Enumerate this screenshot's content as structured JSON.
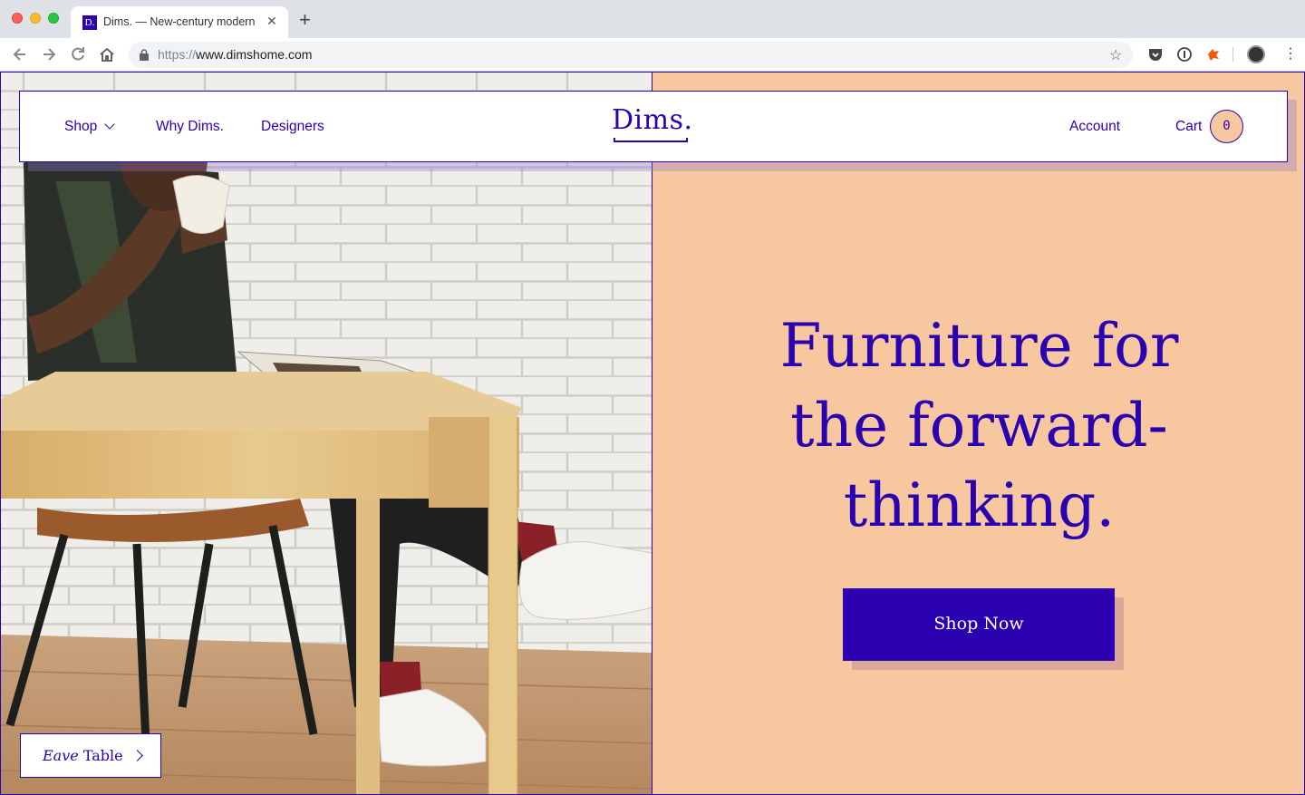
{
  "browser": {
    "tab_title": "Dims. — New-century modern",
    "favicon_text": "D.",
    "url_scheme": "https://",
    "url_host": "www.dimshome.com"
  },
  "header": {
    "nav": {
      "shop": "Shop",
      "why": "Why Dims.",
      "designers": "Designers"
    },
    "logo": "Dims.",
    "account": "Account",
    "cart": "Cart",
    "cart_count": "0"
  },
  "hero": {
    "headline_line1": "Furniture for",
    "headline_line2": "the forward-",
    "headline_line3": "thinking.",
    "cta": "Shop Now",
    "product_name_italic": "Eave",
    "product_name_rest": "Table"
  },
  "colors": {
    "brand": "#2a00b0",
    "peach": "#f7c8a0"
  }
}
